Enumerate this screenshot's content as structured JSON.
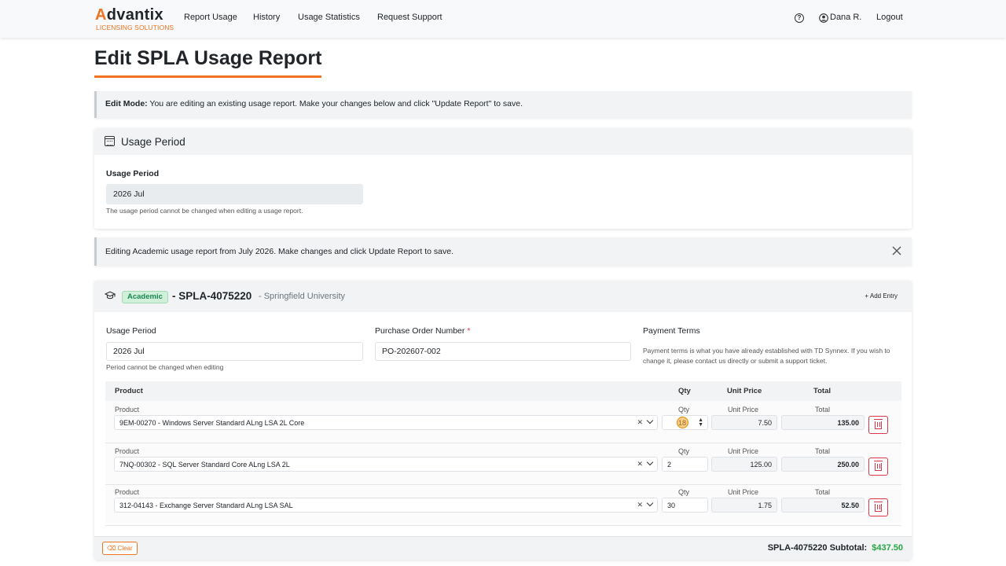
{
  "nav": {
    "logo_letter": "A",
    "logo_rest": "dvantix",
    "logo_sub": "LICENSING SOLUTIONS",
    "links": [
      "Report Usage",
      "History",
      "Usage Statistics",
      "Request Support"
    ],
    "help": "?",
    "user": "Dana R.",
    "logout": "Logout"
  },
  "page": {
    "title": "Edit SPLA Usage Report"
  },
  "edit_alert": {
    "label": "Edit Mode:",
    "text": " You are editing an existing usage report. Make your changes below and click \"Update Report\" to save."
  },
  "usage_period_card": {
    "title": "Usage Period",
    "field_label": "Usage Period",
    "value": "2026 Jul",
    "hint": "The usage period cannot be changed when editing a usage report."
  },
  "info_alert": {
    "text": "Editing Academic usage report from July 2026. Make changes and click Update Report to save."
  },
  "report_card": {
    "badge": "Academic",
    "title": "- SPLA-4075220",
    "school": "- Springfield University",
    "add_entry": "+ Add Entry",
    "usage_period_label": "Usage Period",
    "usage_period_value": "2026 Jul",
    "usage_period_hint": "Period cannot be changed when editing",
    "po_label": "Purchase Order Number",
    "po_required": "*",
    "po_value": "PO-202607-002",
    "payment_label": "Payment Terms",
    "payment_text": "Payment terms is what you have already established with TD Synnex. If you wish to change it, please contact us directly or submit a support ticket.",
    "columns": {
      "product": "Product",
      "qty": "Qty",
      "unit_price": "Unit Price",
      "total": "Total"
    },
    "rows": [
      {
        "product": "9EM-00270 - Windows Server Standard ALng LSA 2L Core",
        "qty": "18",
        "unit_price": "7.50",
        "total": "135.00"
      },
      {
        "product": "7NQ-00302 - SQL Server Standard Core ALng LSA 2L",
        "qty": "2",
        "unit_price": "125.00",
        "total": "250.00"
      },
      {
        "product": "312-04143 - Exchange Server Standard ALng LSA SAL",
        "qty": "30",
        "unit_price": "1.75",
        "total": "52.50"
      }
    ],
    "clear": "Clear",
    "subtotal_label": "SPLA-4075220 Subtotal:",
    "subtotal_value": "$437.50"
  },
  "colors": {
    "accent": "#f0731f",
    "success": "#28a745",
    "danger": "#dc3545"
  }
}
